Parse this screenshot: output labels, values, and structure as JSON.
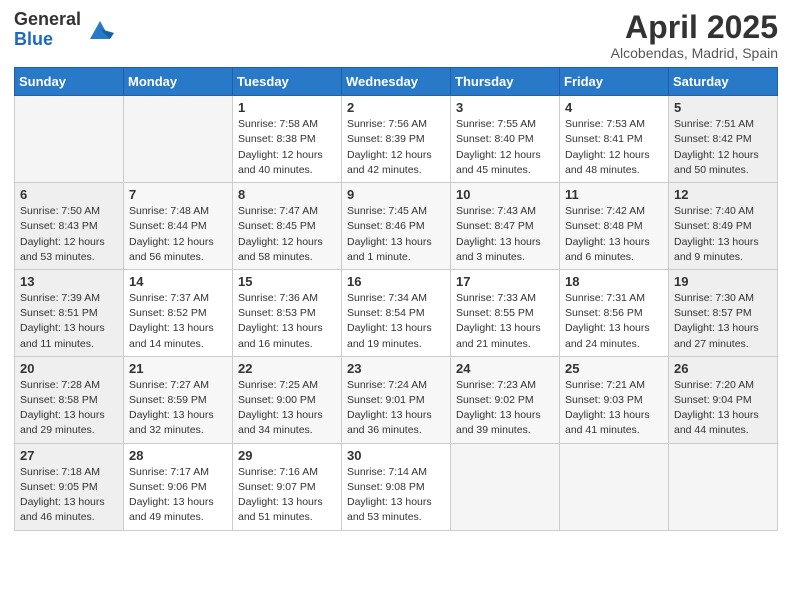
{
  "logo": {
    "general": "General",
    "blue": "Blue"
  },
  "title": "April 2025",
  "subtitle": "Alcobendas, Madrid, Spain",
  "days_header": [
    "Sunday",
    "Monday",
    "Tuesday",
    "Wednesday",
    "Thursday",
    "Friday",
    "Saturday"
  ],
  "weeks": [
    [
      {
        "day": "",
        "sunrise": "",
        "sunset": "",
        "daylight": ""
      },
      {
        "day": "",
        "sunrise": "",
        "sunset": "",
        "daylight": ""
      },
      {
        "day": "1",
        "sunrise": "Sunrise: 7:58 AM",
        "sunset": "Sunset: 8:38 PM",
        "daylight": "Daylight: 12 hours and 40 minutes."
      },
      {
        "day": "2",
        "sunrise": "Sunrise: 7:56 AM",
        "sunset": "Sunset: 8:39 PM",
        "daylight": "Daylight: 12 hours and 42 minutes."
      },
      {
        "day": "3",
        "sunrise": "Sunrise: 7:55 AM",
        "sunset": "Sunset: 8:40 PM",
        "daylight": "Daylight: 12 hours and 45 minutes."
      },
      {
        "day": "4",
        "sunrise": "Sunrise: 7:53 AM",
        "sunset": "Sunset: 8:41 PM",
        "daylight": "Daylight: 12 hours and 48 minutes."
      },
      {
        "day": "5",
        "sunrise": "Sunrise: 7:51 AM",
        "sunset": "Sunset: 8:42 PM",
        "daylight": "Daylight: 12 hours and 50 minutes."
      }
    ],
    [
      {
        "day": "6",
        "sunrise": "Sunrise: 7:50 AM",
        "sunset": "Sunset: 8:43 PM",
        "daylight": "Daylight: 12 hours and 53 minutes."
      },
      {
        "day": "7",
        "sunrise": "Sunrise: 7:48 AM",
        "sunset": "Sunset: 8:44 PM",
        "daylight": "Daylight: 12 hours and 56 minutes."
      },
      {
        "day": "8",
        "sunrise": "Sunrise: 7:47 AM",
        "sunset": "Sunset: 8:45 PM",
        "daylight": "Daylight: 12 hours and 58 minutes."
      },
      {
        "day": "9",
        "sunrise": "Sunrise: 7:45 AM",
        "sunset": "Sunset: 8:46 PM",
        "daylight": "Daylight: 13 hours and 1 minute."
      },
      {
        "day": "10",
        "sunrise": "Sunrise: 7:43 AM",
        "sunset": "Sunset: 8:47 PM",
        "daylight": "Daylight: 13 hours and 3 minutes."
      },
      {
        "day": "11",
        "sunrise": "Sunrise: 7:42 AM",
        "sunset": "Sunset: 8:48 PM",
        "daylight": "Daylight: 13 hours and 6 minutes."
      },
      {
        "day": "12",
        "sunrise": "Sunrise: 7:40 AM",
        "sunset": "Sunset: 8:49 PM",
        "daylight": "Daylight: 13 hours and 9 minutes."
      }
    ],
    [
      {
        "day": "13",
        "sunrise": "Sunrise: 7:39 AM",
        "sunset": "Sunset: 8:51 PM",
        "daylight": "Daylight: 13 hours and 11 minutes."
      },
      {
        "day": "14",
        "sunrise": "Sunrise: 7:37 AM",
        "sunset": "Sunset: 8:52 PM",
        "daylight": "Daylight: 13 hours and 14 minutes."
      },
      {
        "day": "15",
        "sunrise": "Sunrise: 7:36 AM",
        "sunset": "Sunset: 8:53 PM",
        "daylight": "Daylight: 13 hours and 16 minutes."
      },
      {
        "day": "16",
        "sunrise": "Sunrise: 7:34 AM",
        "sunset": "Sunset: 8:54 PM",
        "daylight": "Daylight: 13 hours and 19 minutes."
      },
      {
        "day": "17",
        "sunrise": "Sunrise: 7:33 AM",
        "sunset": "Sunset: 8:55 PM",
        "daylight": "Daylight: 13 hours and 21 minutes."
      },
      {
        "day": "18",
        "sunrise": "Sunrise: 7:31 AM",
        "sunset": "Sunset: 8:56 PM",
        "daylight": "Daylight: 13 hours and 24 minutes."
      },
      {
        "day": "19",
        "sunrise": "Sunrise: 7:30 AM",
        "sunset": "Sunset: 8:57 PM",
        "daylight": "Daylight: 13 hours and 27 minutes."
      }
    ],
    [
      {
        "day": "20",
        "sunrise": "Sunrise: 7:28 AM",
        "sunset": "Sunset: 8:58 PM",
        "daylight": "Daylight: 13 hours and 29 minutes."
      },
      {
        "day": "21",
        "sunrise": "Sunrise: 7:27 AM",
        "sunset": "Sunset: 8:59 PM",
        "daylight": "Daylight: 13 hours and 32 minutes."
      },
      {
        "day": "22",
        "sunrise": "Sunrise: 7:25 AM",
        "sunset": "Sunset: 9:00 PM",
        "daylight": "Daylight: 13 hours and 34 minutes."
      },
      {
        "day": "23",
        "sunrise": "Sunrise: 7:24 AM",
        "sunset": "Sunset: 9:01 PM",
        "daylight": "Daylight: 13 hours and 36 minutes."
      },
      {
        "day": "24",
        "sunrise": "Sunrise: 7:23 AM",
        "sunset": "Sunset: 9:02 PM",
        "daylight": "Daylight: 13 hours and 39 minutes."
      },
      {
        "day": "25",
        "sunrise": "Sunrise: 7:21 AM",
        "sunset": "Sunset: 9:03 PM",
        "daylight": "Daylight: 13 hours and 41 minutes."
      },
      {
        "day": "26",
        "sunrise": "Sunrise: 7:20 AM",
        "sunset": "Sunset: 9:04 PM",
        "daylight": "Daylight: 13 hours and 44 minutes."
      }
    ],
    [
      {
        "day": "27",
        "sunrise": "Sunrise: 7:18 AM",
        "sunset": "Sunset: 9:05 PM",
        "daylight": "Daylight: 13 hours and 46 minutes."
      },
      {
        "day": "28",
        "sunrise": "Sunrise: 7:17 AM",
        "sunset": "Sunset: 9:06 PM",
        "daylight": "Daylight: 13 hours and 49 minutes."
      },
      {
        "day": "29",
        "sunrise": "Sunrise: 7:16 AM",
        "sunset": "Sunset: 9:07 PM",
        "daylight": "Daylight: 13 hours and 51 minutes."
      },
      {
        "day": "30",
        "sunrise": "Sunrise: 7:14 AM",
        "sunset": "Sunset: 9:08 PM",
        "daylight": "Daylight: 13 hours and 53 minutes."
      },
      {
        "day": "",
        "sunrise": "",
        "sunset": "",
        "daylight": ""
      },
      {
        "day": "",
        "sunrise": "",
        "sunset": "",
        "daylight": ""
      },
      {
        "day": "",
        "sunrise": "",
        "sunset": "",
        "daylight": ""
      }
    ]
  ]
}
